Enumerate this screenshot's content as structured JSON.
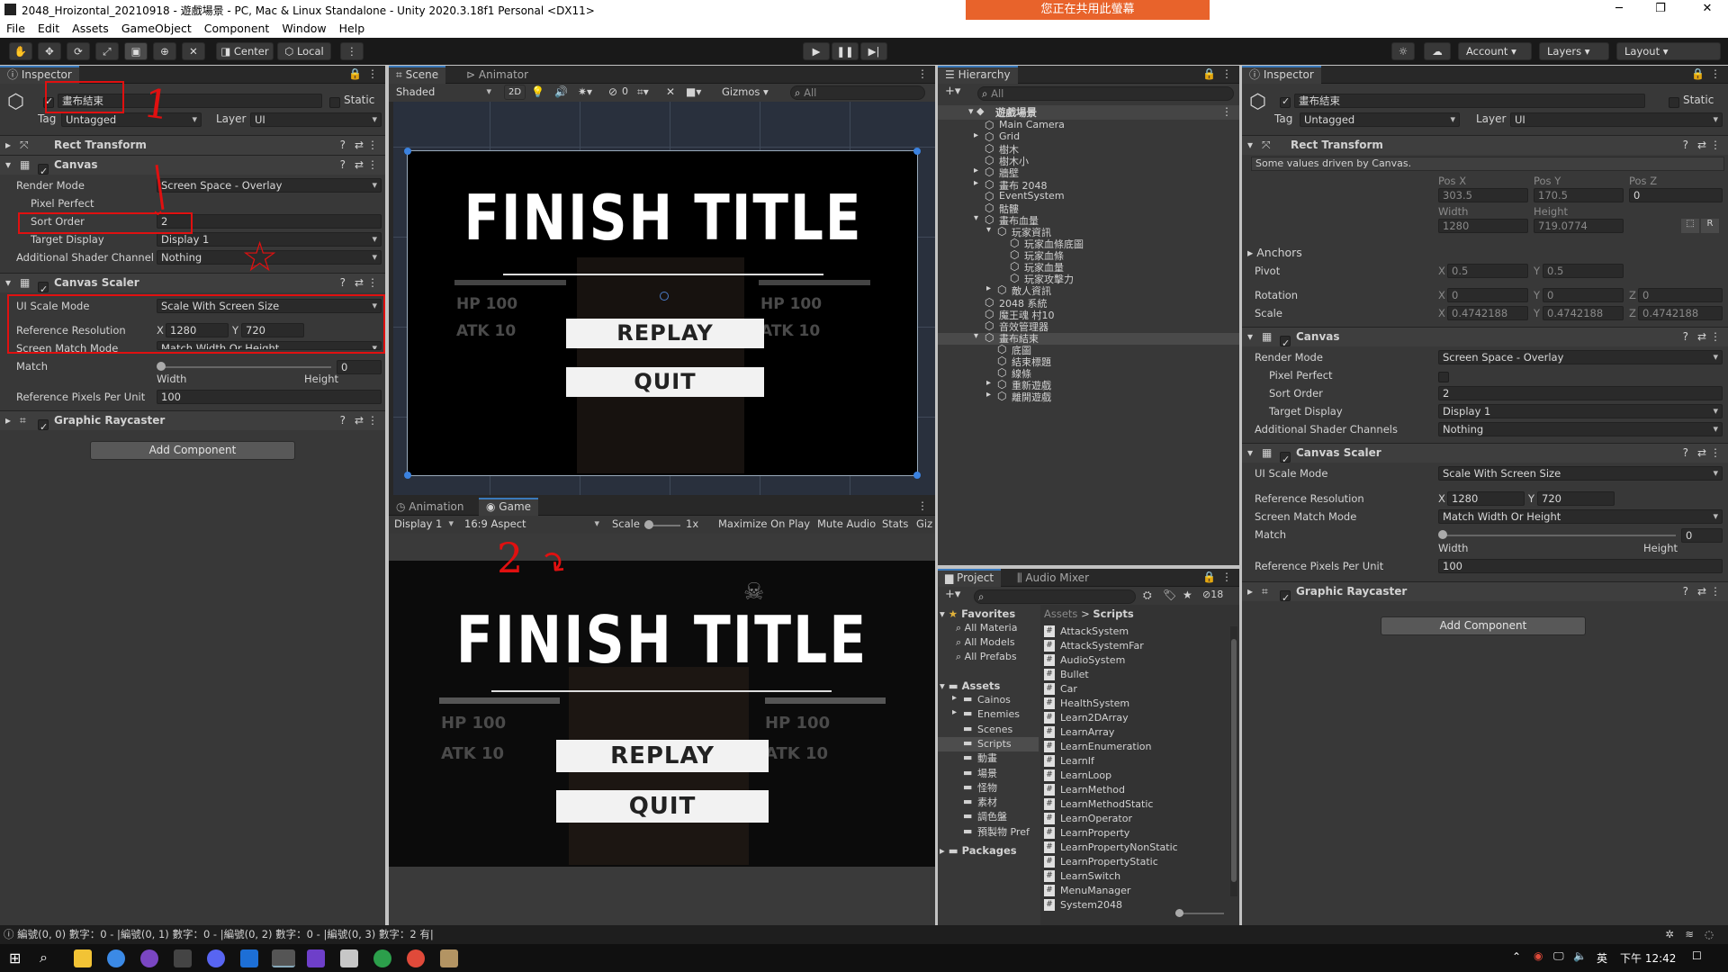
{
  "window": {
    "title": "2048_Hroizontal_20210918 - 遊戲場景 - PC, Mac & Linux Standalone - Unity 2020.3.18f1 Personal <DX11>",
    "share": "您正在共用此螢幕",
    "min": "─",
    "max": "❐",
    "close": "✕"
  },
  "menu": [
    "File",
    "Edit",
    "Assets",
    "GameObject",
    "Component",
    "Window",
    "Help"
  ],
  "toolbar": {
    "center": "Center",
    "local": "Local",
    "account": "Account",
    "layers": "Layers",
    "layout": "Layout"
  },
  "inspector_left": {
    "tab": "Inspector",
    "name": "畫布結束",
    "static": "Static",
    "tag_label": "Tag",
    "tag": "Untagged",
    "layer_label": "Layer",
    "layer": "UI",
    "rect_transform": "Rect Transform",
    "canvas": "Canvas",
    "render_mode_label": "Render Mode",
    "render_mode": "Screen Space - Overlay",
    "pixel_perfect": "Pixel Perfect",
    "sort_order_label": "Sort Order",
    "sort_order": "2",
    "target_display_label": "Target Display",
    "target_display": "Display 1",
    "shader_label": "Additional Shader Channel",
    "shader": "Nothing",
    "canvas_scaler": "Canvas Scaler",
    "ui_scale_label": "UI Scale Mode",
    "ui_scale": "Scale With Screen Size",
    "ref_res_label": "Reference Resolution",
    "x": "1280",
    "y": "720",
    "screen_match_label": "Screen Match Mode",
    "screen_match": "Match Width Or Height",
    "match_label": "Match",
    "match": "0",
    "width": "Width",
    "height": "Height",
    "ppu_label": "Reference Pixels Per Unit",
    "ppu": "100",
    "raycaster": "Graphic Raycaster",
    "add_component": "Add Component",
    "anno1": "1",
    "anno2": "2"
  },
  "scene": {
    "tab": "Scene",
    "animator": "Animator",
    "shaded": "Shaded",
    "two_d": "2D",
    "zero": "0",
    "gizmos": "Gizmos",
    "all": "All"
  },
  "game_ui": {
    "title": "FINISH TITLE",
    "replay": "REPLAY",
    "quit": "QUIT",
    "hp": "HP 100",
    "atk": "ATK 10"
  },
  "game": {
    "animation": "Animation",
    "tab": "Game",
    "display": "Display 1",
    "aspect": "16:9 Aspect",
    "scale": "Scale",
    "scale_val": "1x",
    "maximize": "Maximize On Play",
    "mute": "Mute Audio",
    "stats": "Stats",
    "giz": "Giz",
    "anno": "2"
  },
  "hierarchy": {
    "tab": "Hierarchy",
    "search": "All",
    "items": [
      "遊戲場景",
      "Main Camera",
      "Grid",
      "樹木",
      "樹木小",
      "牆壁",
      "畫布 2048",
      "EventSystem",
      "骷髏",
      "畫布血量",
      "玩家資訊",
      "玩家血條底圖",
      "玩家血條",
      "玩家血量",
      "玩家攻擊力",
      "敵人資訊",
      "2048 系統",
      "魔王魂 村10",
      "音效管理器",
      "畫布結束",
      "底圖",
      "結束標題",
      "線條",
      "重新遊戲",
      "離開遊戲"
    ]
  },
  "project": {
    "tab": "Project",
    "audio_mixer": "Audio Mixer",
    "count": "18",
    "favorites": "Favorites",
    "fav_items": [
      "All Materia",
      "All Models",
      "All Prefabs"
    ],
    "assets": "Assets",
    "asset_folders": [
      "Cainos",
      "Enemies",
      "Scenes",
      "Scripts",
      "動畫",
      "場景",
      "怪物",
      "素材",
      "調色盤",
      "預製物 Pref"
    ],
    "packages": "Packages",
    "breadcrumb_assets": "Assets",
    "breadcrumb_scripts": "Scripts",
    "scripts": [
      "AttackSystem",
      "AttackSystemFar",
      "AudioSystem",
      "Bullet",
      "Car",
      "HealthSystem",
      "Learn2DArray",
      "LearnArray",
      "LearnEnumeration",
      "LearnIf",
      "LearnLoop",
      "LearnMethod",
      "LearnMethodStatic",
      "LearnOperator",
      "LearnProperty",
      "LearnPropertyNonStatic",
      "LearnPropertyStatic",
      "LearnSwitch",
      "MenuManager",
      "System2048"
    ]
  },
  "inspector_right": {
    "tab": "Inspector",
    "name": "畫布結束",
    "static": "Static",
    "tag_label": "Tag",
    "tag": "Untagged",
    "layer_label": "Layer",
    "layer": "UI",
    "rect_transform": "Rect Transform",
    "driven": "Some values driven by Canvas.",
    "posx_l": "Pos X",
    "posy_l": "Pos Y",
    "posz_l": "Pos Z",
    "posx": "303.5",
    "posy": "170.5",
    "posz": "0",
    "width_l": "Width",
    "height_l": "Height",
    "width": "1280",
    "height": "719.0774",
    "anchors": "Anchors",
    "pivot_l": "Pivot",
    "pivot_x": "0.5",
    "pivot_y": "0.5",
    "rotation_l": "Rotation",
    "rot_x": "0",
    "rot_y": "0",
    "rot_z": "0",
    "scale_l": "Scale",
    "scale_x": "0.4742188",
    "scale_y": "0.4742188",
    "scale_z": "0.4742188",
    "canvas": "Canvas",
    "render_mode_label": "Render Mode",
    "render_mode": "Screen Space - Overlay",
    "pixel_perfect": "Pixel Perfect",
    "sort_order_label": "Sort Order",
    "sort_order": "2",
    "target_display_label": "Target Display",
    "target_display": "Display 1",
    "shader_label": "Additional Shader Channels",
    "shader": "Nothing",
    "canvas_scaler": "Canvas Scaler",
    "ui_scale_label": "UI Scale Mode",
    "ui_scale": "Scale With Screen Size",
    "ref_res_label": "Reference Resolution",
    "x": "1280",
    "y": "720",
    "screen_match_label": "Screen Match Mode",
    "screen_match": "Match Width Or Height",
    "match_label": "Match",
    "match": "0",
    "width_w": "Width",
    "height_w": "Height",
    "ppu_label": "Reference Pixels Per Unit",
    "ppu": "100",
    "raycaster": "Graphic Raycaster",
    "add_component": "Add Component"
  },
  "status": {
    "text": "編號(0, 0) 數字：0 - |編號(0, 1) 數字：0 - |編號(0, 2) 數字：0 - |編號(0, 3) 數字：2 有|"
  },
  "taskbar": {
    "lang": "英",
    "time": "下午 12:42"
  }
}
